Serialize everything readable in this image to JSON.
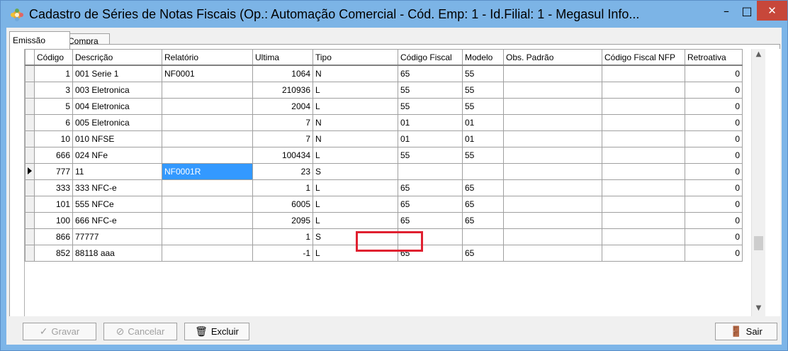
{
  "window": {
    "title": "Cadastro de Séries de Notas Fiscais (Op.: Automação Comercial - Cód. Emp: 1 - Id.Filial: 1 - Megasul Info...",
    "app_icon": "gear-flower-icon",
    "minimize_glyph": "–",
    "maximize_glyph": "□",
    "close_glyph": "✕"
  },
  "tabs": [
    {
      "label": "Emissão"
    },
    {
      "label": "Compra"
    }
  ],
  "grid": {
    "columns": [
      "Código",
      "Descrição",
      "Relatório",
      "Ultima",
      "Tipo",
      "Código Fiscal",
      "Modelo",
      "Obs. Padrão",
      "Código Fiscal NFP",
      "Retroativa"
    ],
    "rows": [
      [
        "1",
        "001 Serie 1",
        "NF0001",
        "1064",
        "N",
        "65",
        "55",
        "",
        "",
        "0"
      ],
      [
        "3",
        "003 Eletronica",
        "",
        "210936",
        "L",
        "55",
        "55",
        "",
        "",
        "0"
      ],
      [
        "5",
        "004 Eletronica",
        "",
        "2004",
        "L",
        "55",
        "55",
        "",
        "",
        "0"
      ],
      [
        "6",
        "005 Eletronica",
        "",
        "7",
        "N",
        "01",
        "01",
        "",
        "",
        "0"
      ],
      [
        "10",
        "010 NFSE",
        "",
        "7",
        "N",
        "01",
        "01",
        "",
        "",
        "0"
      ],
      [
        "666",
        "024  NFe",
        "",
        "100434",
        "L",
        "55",
        "55",
        "",
        "",
        "0"
      ],
      [
        "777",
        "11",
        "NF0001R",
        "23",
        "S",
        "",
        "",
        "",
        "",
        "0"
      ],
      [
        "333",
        "333 NFC-e",
        "",
        "1",
        "L",
        "65",
        "65",
        "",
        "",
        "0"
      ],
      [
        "101",
        "555 NFCe",
        "",
        "6005",
        "L",
        "65",
        "65",
        "",
        "",
        "0"
      ],
      [
        "100",
        "666 NFC-e",
        "",
        "2095",
        "L",
        "65",
        "65",
        "",
        "",
        "0"
      ],
      [
        "866",
        "77777",
        "",
        "1",
        "S",
        "",
        "",
        "",
        "",
        "0"
      ],
      [
        "852",
        "88118 aaa",
        "",
        "-1",
        "L",
        "65",
        "65",
        "",
        "",
        "0"
      ]
    ],
    "selected_row": 6
  },
  "buttons": {
    "gravar": "Gravar",
    "cancelar": "Cancelar",
    "excluir": "Excluir",
    "sair": "Sair"
  }
}
